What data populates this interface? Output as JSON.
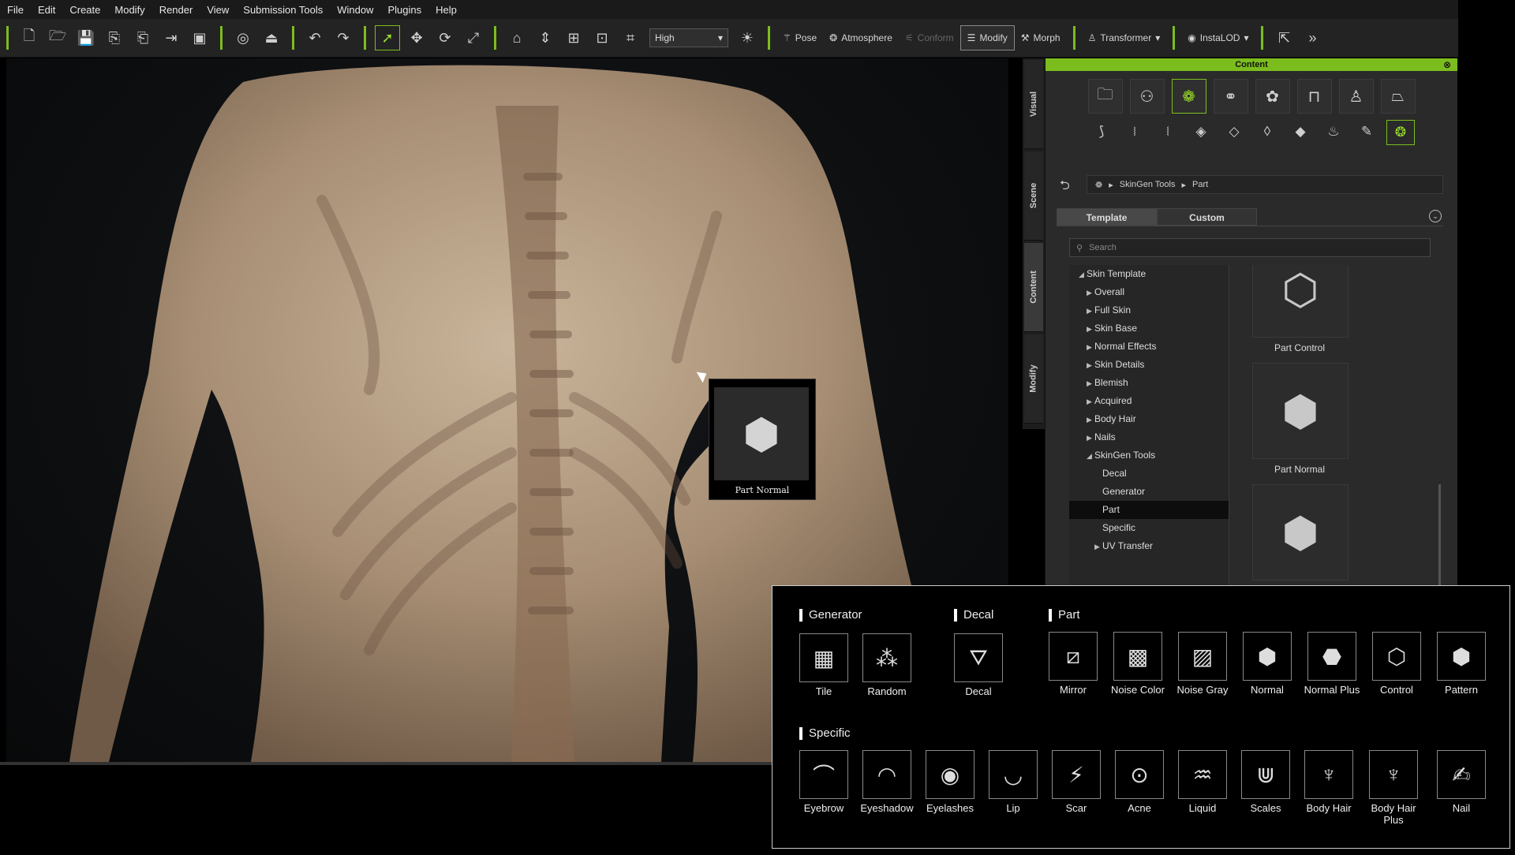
{
  "menu": [
    "File",
    "Edit",
    "Create",
    "Modify",
    "Render",
    "View",
    "Submission Tools",
    "Window",
    "Plugins",
    "Help"
  ],
  "toolbar": {
    "quality_value": "High",
    "labeled_buttons": [
      {
        "label": "Pose",
        "state": "normal",
        "icon": "pose-icon"
      },
      {
        "label": "Atmosphere",
        "state": "normal",
        "icon": "atmosphere-icon"
      },
      {
        "label": "Conform",
        "state": "disabled",
        "icon": "conform-icon"
      },
      {
        "label": "Modify",
        "state": "selected",
        "icon": "modify-icon"
      },
      {
        "label": "Morph",
        "state": "normal",
        "icon": "morph-icon"
      },
      {
        "label": "Transformer",
        "state": "normal",
        "icon": "transformer-icon"
      },
      {
        "label": "InstaLOD",
        "state": "normal",
        "icon": "instalod-icon"
      }
    ]
  },
  "side_tabs": [
    "Visual",
    "Scene",
    "Content",
    "Modify"
  ],
  "panel": {
    "title": "Content",
    "breadcrumb": [
      "SkinGen Tools",
      "Part"
    ],
    "tabs": [
      "Template",
      "Custom"
    ],
    "search_placeholder": "Search",
    "tree": [
      {
        "label": "Skin Template",
        "level": 0,
        "expanded": true
      },
      {
        "label": "Overall",
        "level": 1
      },
      {
        "label": "Full Skin",
        "level": 1
      },
      {
        "label": "Skin Base",
        "level": 1
      },
      {
        "label": "Normal Effects",
        "level": 1
      },
      {
        "label": "Skin Details",
        "level": 1
      },
      {
        "label": "Blemish",
        "level": 1
      },
      {
        "label": "Acquired",
        "level": 1
      },
      {
        "label": "Body Hair",
        "level": 1
      },
      {
        "label": "Nails",
        "level": 1
      },
      {
        "label": "SkinGen Tools",
        "level": 1,
        "expanded": true
      },
      {
        "label": "Decal",
        "level": 2
      },
      {
        "label": "Generator",
        "level": 2
      },
      {
        "label": "Part",
        "level": 2,
        "selected": true
      },
      {
        "label": "Specific",
        "level": 2
      },
      {
        "label": "UV Transfer",
        "level": 2,
        "collapsed": true
      }
    ],
    "tiles": [
      "Part Control",
      "Part Normal",
      ""
    ]
  },
  "drag_item": {
    "label": "Part Normal"
  },
  "legend": {
    "generator_title": "Generator",
    "decal_title": "Decal",
    "part_title": "Part",
    "specific_title": "Specific",
    "generator": [
      "Tile",
      "Random"
    ],
    "decal": [
      "Decal"
    ],
    "part": [
      "Mirror",
      "Noise Color",
      "Noise Gray",
      "Normal",
      "Normal Plus",
      "Control",
      "Pattern"
    ],
    "specific": [
      "Eyebrow",
      "Eyeshadow",
      "Eyelashes",
      "Lip",
      "Scar",
      "Acne",
      "Liquid",
      "Scales",
      "Body Hair",
      "Body Hair Plus",
      "Nail"
    ]
  },
  "colors": {
    "accent": "#7cbd1e",
    "panel_bg": "#2a2a2a",
    "toolbar_bg": "#232323"
  }
}
